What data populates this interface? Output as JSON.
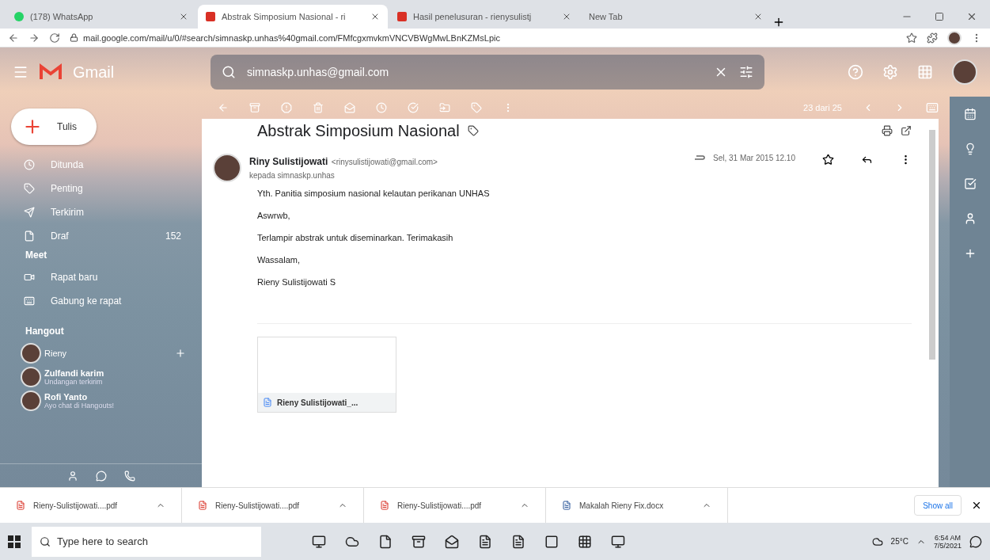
{
  "browser": {
    "tabs": [
      {
        "title": "(178) WhatsApp",
        "kind": "whatsapp",
        "selected": false
      },
      {
        "title": "Abstrak Simposium Nasional - ri",
        "kind": "gmail",
        "selected": true
      },
      {
        "title": "Hasil penelusuran - rienysulistj",
        "kind": "gmail",
        "selected": false
      },
      {
        "title": "New Tab",
        "kind": "blank",
        "selected": false
      }
    ],
    "url": "mail.google.com/mail/u/0/#search/simnaskp.unhas%40gmail.com/FMfcgxmvkmVNCVBWgMwLBnKZMsLpic"
  },
  "gmail": {
    "product": "Gmail",
    "search": "simnaskp.unhas@gmail.com",
    "compose": "Tulis",
    "nav": [
      {
        "label": "Ditunda",
        "kind": "clock"
      },
      {
        "label": "Penting",
        "kind": "important"
      },
      {
        "label": "Terkirim",
        "kind": "send"
      },
      {
        "label": "Draf",
        "kind": "draft",
        "count": "152"
      }
    ],
    "meet": {
      "title": "Meet",
      "items": [
        {
          "label": "Rapat baru",
          "kind": "video"
        },
        {
          "label": "Gabung ke rapat",
          "kind": "keyboard"
        }
      ]
    },
    "hangout": {
      "title": "Hangout",
      "me": "Rieny",
      "contacts": [
        {
          "name": "Zulfandi karim",
          "status": "Undangan terkirim"
        },
        {
          "name": "Rofi Yanto",
          "status": "Ayo chat di Hangouts!"
        }
      ]
    },
    "pager": "23 dari 25",
    "message": {
      "subject": "Abstrak Simposium Nasional",
      "sender": "Riny Sulistijowati",
      "email": "<rinysulistijowati@gmail.com>",
      "to": "kepada simnaskp.unhas",
      "date": "Sel, 31 Mar 2015 12.10",
      "body": [
        "Yth. Panitia simposium nasional kelautan perikanan UNHAS",
        "Aswrwb,",
        "Terlampir abstrak untuk diseminarkan. Terimakasih",
        "Wassalam,",
        "Rieny Sulistijowati S"
      ],
      "attachment": "Rieny Sulistijowati_..."
    }
  },
  "downloads": {
    "items": [
      {
        "name": "Rieny-Sulistijowati....pdf",
        "kind": "pdf"
      },
      {
        "name": "Rieny-Sulistijowati....pdf",
        "kind": "pdf"
      },
      {
        "name": "Rieny-Sulistijowati....pdf",
        "kind": "pdf"
      },
      {
        "name": "Makalah Rieny Fix.docx",
        "kind": "docx"
      }
    ],
    "show_all": "Show all"
  },
  "taskbar": {
    "search": "Type here to search",
    "weather": "25°C",
    "time": "6:54 AM",
    "date": "7/5/2021"
  }
}
